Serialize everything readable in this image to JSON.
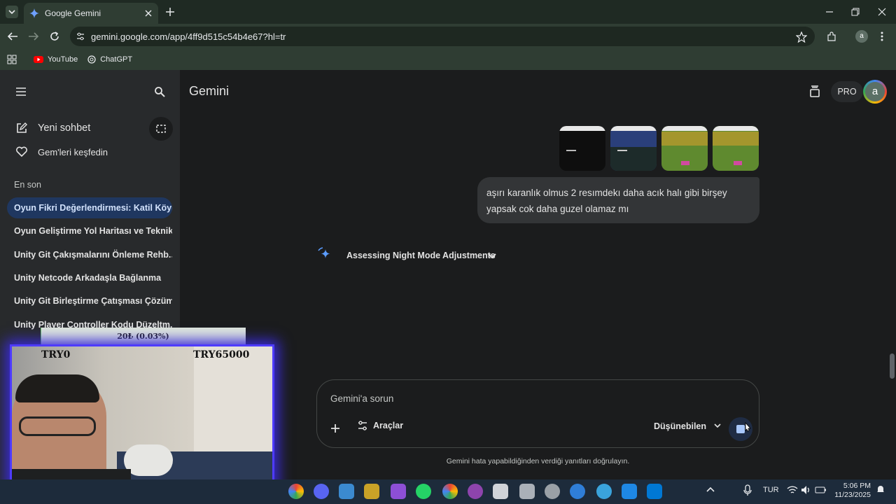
{
  "browser": {
    "tab_title": "Google Gemini",
    "url": "gemini.google.com/app/4ff9d515c54b4e67?hl=tr",
    "bookmarks": [
      "YouTube",
      "ChatGPT"
    ]
  },
  "app": {
    "title": "Gemini",
    "pro_label": "PRO",
    "avatar_letter": "a"
  },
  "sidebar": {
    "new_chat": "Yeni sohbet",
    "explore_gems": "Gem'leri keşfedin",
    "recent_heading": "En son",
    "recent": [
      "Oyun Fikri Değerlendirmesi: Katil Köylü",
      "Oyun Geliştirme Yol Haritası ve Teknik...",
      "Unity Git Çakışmalarını Önleme Rehb...",
      "Unity Netcode Arkadaşla Bağlanma",
      "Unity Git Birleştirme Çatışması Çözümü",
      "Unity Player Controller Kodu Düzeltm..."
    ]
  },
  "chat": {
    "user_message": "aşırı karanlık olmus 2 resımdekı daha acık halı gibi birşey yapsak cok daha guzel olamaz mı",
    "thinking_label": "Assessing Night Mode Adjustments"
  },
  "composer": {
    "placeholder": "Gemini'a sorun",
    "tools_label": "Araçlar",
    "model_label": "Düşünebilen"
  },
  "disclaimer": "Gemini hata yapabildiğinden verdiği yanıtları doğrulayın.",
  "overlay": {
    "progress_text": "20₺ (0.03%)",
    "left_label": "TRY0",
    "right_label": "TRY65000",
    "progress_fraction": 0.0003
  },
  "taskbar": {
    "language": "TUR",
    "time": "5:06 PM",
    "date": "11/23/2025"
  },
  "colors": {
    "accent_blue": "#1f3760",
    "overlay_glow": "#4e3bff",
    "browser_frame": "#2f3d33"
  }
}
